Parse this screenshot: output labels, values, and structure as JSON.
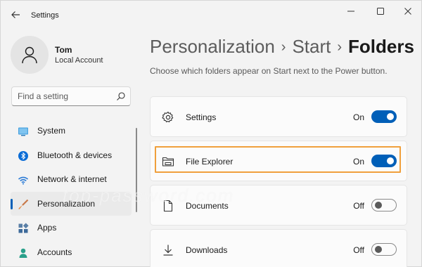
{
  "window": {
    "title": "Settings"
  },
  "user": {
    "name": "Tom",
    "account_type": "Local Account"
  },
  "search": {
    "placeholder": "Find a setting"
  },
  "sidebar": {
    "items": [
      {
        "label": "System",
        "icon": "system-icon",
        "active": false
      },
      {
        "label": "Bluetooth & devices",
        "icon": "bluetooth-icon",
        "active": false
      },
      {
        "label": "Network & internet",
        "icon": "wifi-icon",
        "active": false
      },
      {
        "label": "Personalization",
        "icon": "brush-icon",
        "active": true
      },
      {
        "label": "Apps",
        "icon": "apps-icon",
        "active": false
      },
      {
        "label": "Accounts",
        "icon": "person-icon",
        "active": false
      }
    ]
  },
  "breadcrumb": {
    "items": [
      "Personalization",
      "Start",
      "Folders"
    ],
    "separator": "›"
  },
  "main": {
    "description": "Choose which folders appear on Start next to the Power button.",
    "folders": [
      {
        "label": "Settings",
        "state": "On",
        "on": true,
        "icon": "gear-icon"
      },
      {
        "label": "File Explorer",
        "state": "On",
        "on": true,
        "icon": "file-explorer-icon"
      },
      {
        "label": "Documents",
        "state": "Off",
        "on": false,
        "icon": "document-icon"
      },
      {
        "label": "Downloads",
        "state": "Off",
        "on": false,
        "icon": "download-icon"
      }
    ]
  },
  "watermark": "top-password.com",
  "colors": {
    "accent": "#005fb8",
    "highlight": "#f0a03c"
  }
}
